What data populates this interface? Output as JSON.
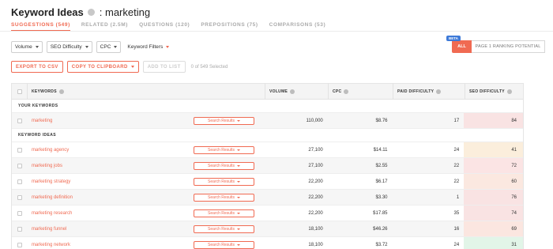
{
  "header": {
    "title": "Keyword Ideas",
    "term": ": marketing"
  },
  "tabs": [
    {
      "label": "SUGGESTIONS (549)",
      "active": true
    },
    {
      "label": "RELATED (2.5M)",
      "active": false
    },
    {
      "label": "QUESTIONS (120)",
      "active": false
    },
    {
      "label": "PREPOSITIONS (75)",
      "active": false
    },
    {
      "label": "COMPARISONS (53)",
      "active": false
    }
  ],
  "filters": {
    "volume": "Volume",
    "seo_difficulty": "SEO Difficulty",
    "cpc": "CPC",
    "keyword_filters": "Keyword Filters"
  },
  "toggle": {
    "beta": "BETA",
    "all": "ALL",
    "page1": "PAGE 1 RANKING POTENTIAL"
  },
  "actions": {
    "export_csv": "EXPORT TO CSV",
    "copy_clipboard": "COPY TO CLIPBOARD",
    "add_to_list": "ADD TO LIST",
    "selected": "0 of 549 Selected"
  },
  "table": {
    "columns": {
      "keywords": "KEYWORDS",
      "volume": "VOLUME",
      "cpc": "CPC",
      "paid_difficulty": "PAID DIFFICULTY",
      "seo_difficulty": "SEO DIFFICULTY"
    },
    "search_results_label": "Search Results",
    "sections": {
      "your_keywords": "YOUR KEYWORDS",
      "keyword_ideas": "KEYWORD IDEAS"
    },
    "your_rows": [
      {
        "keyword": "marketing",
        "volume": "110,000",
        "cpc": "$8.76",
        "pd": "17",
        "sd": "84",
        "sd_color": "#f9e3e3"
      }
    ],
    "idea_rows": [
      {
        "keyword": "marketing agency",
        "volume": "27,100",
        "cpc": "$14.11",
        "pd": "24",
        "sd": "41",
        "sd_color": "#fbeedc"
      },
      {
        "keyword": "marketing jobs",
        "volume": "27,100",
        "cpc": "$2.55",
        "pd": "22",
        "sd": "72",
        "sd_color": "#fbe4e4"
      },
      {
        "keyword": "marketing strategy",
        "volume": "22,200",
        "cpc": "$6.17",
        "pd": "22",
        "sd": "60",
        "sd_color": "#fbe8e0"
      },
      {
        "keyword": "marketing definition",
        "volume": "22,200",
        "cpc": "$3.30",
        "pd": "1",
        "sd": "76",
        "sd_color": "#f9e3e3"
      },
      {
        "keyword": "marketing research",
        "volume": "22,200",
        "cpc": "$17.85",
        "pd": "35",
        "sd": "74",
        "sd_color": "#f9e3e3"
      },
      {
        "keyword": "marketing funnel",
        "volume": "18,100",
        "cpc": "$46.26",
        "pd": "16",
        "sd": "69",
        "sd_color": "#fbe6e0"
      },
      {
        "keyword": "marketing network",
        "volume": "18,100",
        "cpc": "$3.72",
        "pd": "24",
        "sd": "31",
        "sd_color": "#e2f5e8"
      }
    ]
  }
}
